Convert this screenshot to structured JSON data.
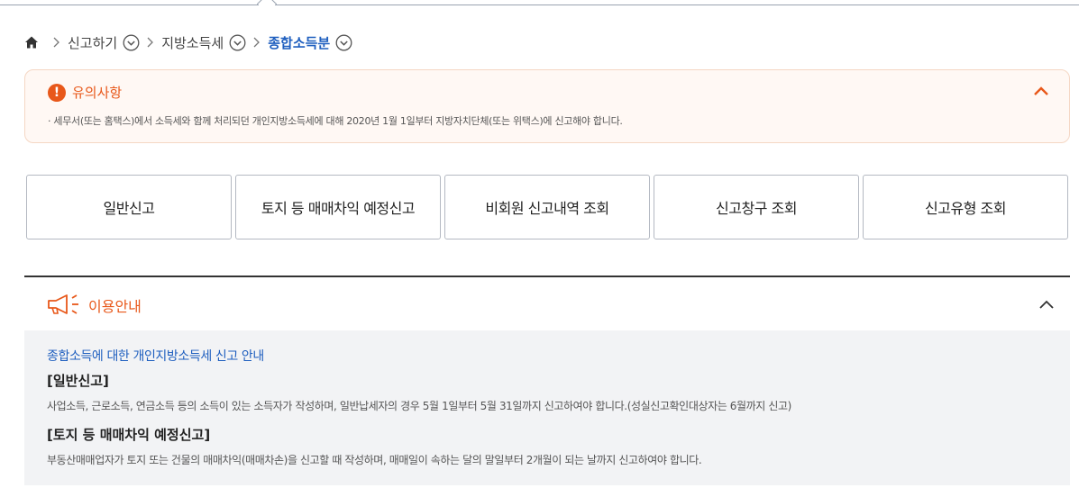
{
  "breadcrumb": {
    "items": [
      {
        "label": "신고하기"
      },
      {
        "label": "지방소득세"
      },
      {
        "label": "종합소득분"
      }
    ]
  },
  "notice": {
    "title": "유의사항",
    "body": "· 세무서(또는 홈택스)에서 소득세와 함께 처리되던 개인지방소득세에 대해 2020년 1월 1일부터 지방자치단체(또는 위택스)에 신고해야 합니다."
  },
  "actions": [
    {
      "label": "일반신고"
    },
    {
      "label": "토지 등 매매차익 예정신고"
    },
    {
      "label": "비회원 신고내역 조회"
    },
    {
      "label": "신고창구 조회"
    },
    {
      "label": "신고유형 조회"
    }
  ],
  "guide": {
    "title": "이용안내",
    "subtitle": "종합소득에 대한 개인지방소득세 신고 안내",
    "sections": [
      {
        "heading": "[일반신고]",
        "text": "사업소득, 근로소득, 연금소득 등의 소득이 있는 소득자가 작성하며, 일반납세자의 경우 5월 1일부터 5월 31일까지 신고하여야 합니다.(성실신고확인대상자는 6월까지 신고)"
      },
      {
        "heading": "[토지 등 매매차익 예정신고]",
        "text": "부동산매매업자가 토지 또는 건물의 매매차익(매매차손)을 신고할 때 작성하며, 매매일이 속하는 달의 말일부터 2개월이 되는 날까지 신고하여야 합니다."
      }
    ]
  },
  "colors": {
    "accent": "#e8581a",
    "link_blue": "#1f5fbf",
    "notice_bg": "#fff8f4",
    "guide_bg": "#f2f3f5"
  }
}
